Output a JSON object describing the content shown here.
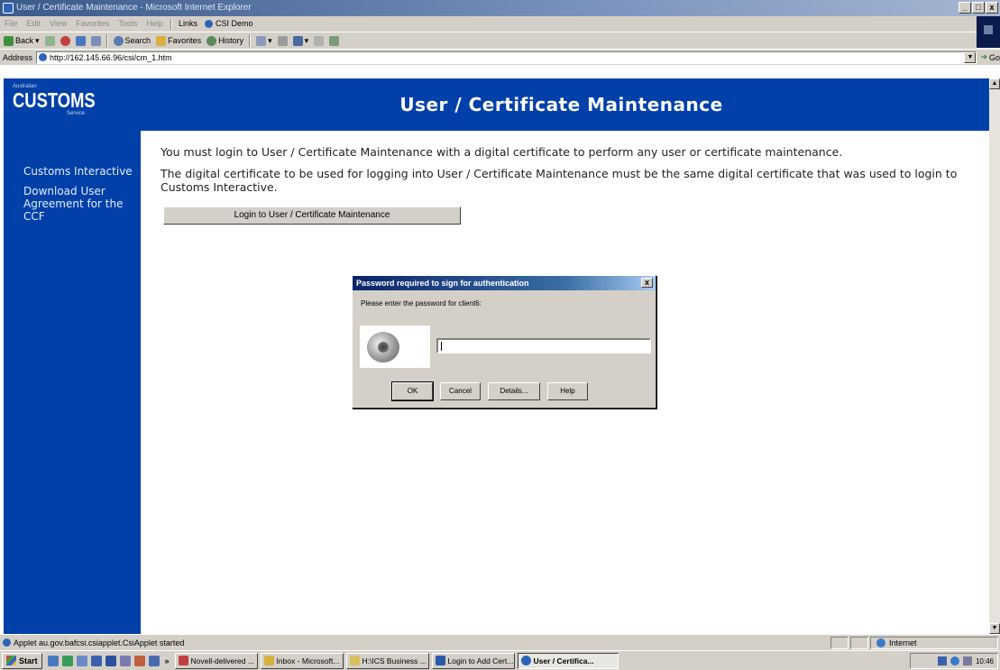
{
  "window": {
    "title": "User / Certificate Maintenance - Microsoft Internet Explorer",
    "buttons": {
      "minimize": "_",
      "maximize": "□",
      "close": "x"
    }
  },
  "menubar": {
    "items": [
      "File",
      "Edit",
      "View",
      "Favorites",
      "Tools",
      "Help"
    ],
    "links_label": "Links",
    "link_item": "CSI Demo"
  },
  "toolbar": {
    "back": "Back",
    "search": "Search",
    "favorites": "Favorites",
    "history": "History"
  },
  "address": {
    "label": "Address",
    "url": "http://162.145.66.96/csi/cm_1.htm",
    "go": "Go"
  },
  "page": {
    "logo": {
      "top": "Australian",
      "main": "CUSTOMS",
      "sub": "Service"
    },
    "heading": "User / Certificate Maintenance",
    "sidebar": [
      "Customs Interactive",
      "Download User Agreement for the CCF"
    ],
    "paragraphs": [
      "You must login to User / Certificate Maintenance with a digital certificate to perform any user or certificate maintenance.",
      "The digital certificate to be used for logging into User / Certificate Maintenance must be the same digital certificate that was used to login to Customs Interactive."
    ],
    "login_button": "Login to User / Certificate Maintenance"
  },
  "dialog": {
    "title": "Password required to sign for authentication",
    "prompt": "Please enter the password for client6:",
    "password_value": "",
    "buttons": {
      "ok": "OK",
      "cancel": "Cancel",
      "details": "Details...",
      "help": "Help"
    }
  },
  "statusbar": {
    "text": "Applet au.gov.bafcsi.csiapplet.CsiApplet started",
    "zone": "Internet"
  },
  "taskbar": {
    "start": "Start",
    "tasks": [
      "Novell-delivered ...",
      "Inbox - Microsoft...",
      "H:\\ICS Business ...",
      "Login to Add Cert...",
      "User / Certifica..."
    ],
    "active_task_index": 4,
    "clock": "10:46"
  }
}
